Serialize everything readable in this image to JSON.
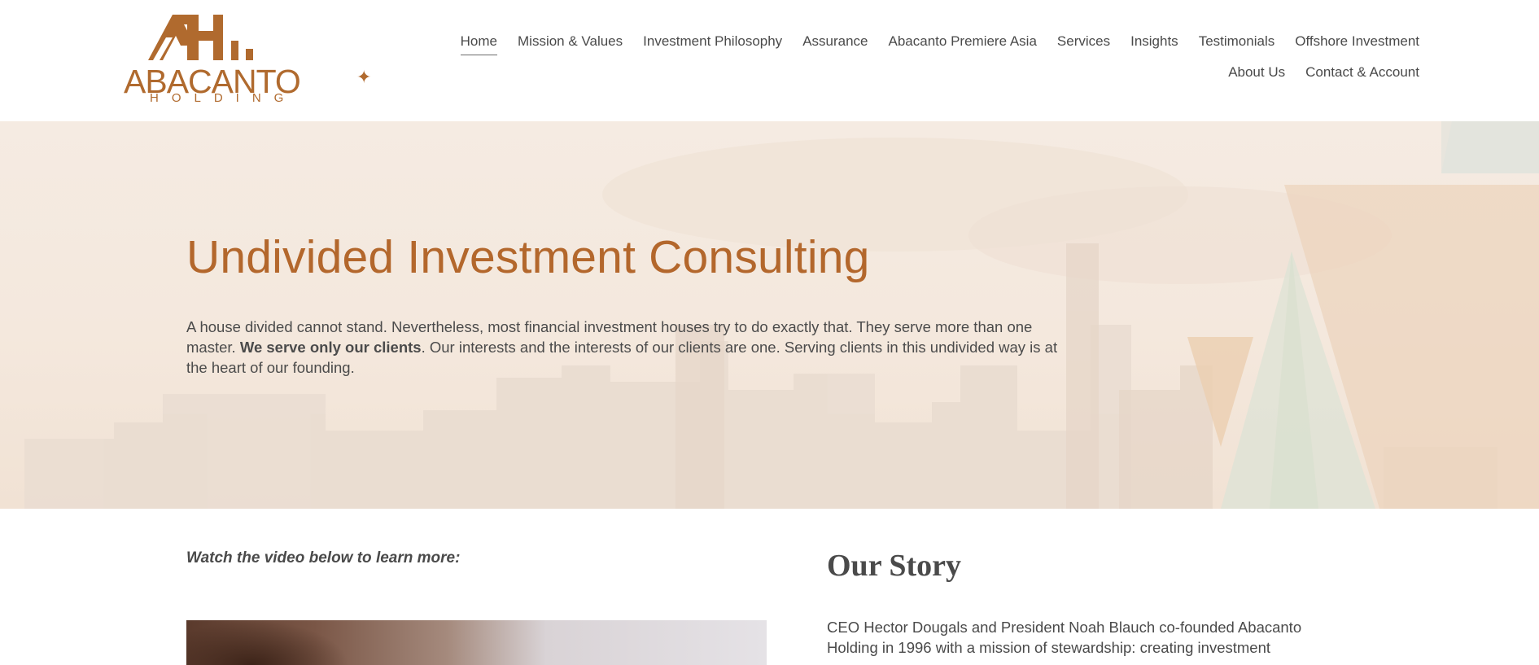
{
  "brand": {
    "name": "ABACANTO",
    "sub": "HOLDING",
    "accent": "#b3672c"
  },
  "nav": {
    "row1": [
      {
        "label": "Home",
        "active": true
      },
      {
        "label": "Mission & Values"
      },
      {
        "label": "Investment Philosophy"
      },
      {
        "label": "Assurance"
      },
      {
        "label": "Abacanto Premiere Asia"
      },
      {
        "label": "Services"
      },
      {
        "label": "Insights"
      },
      {
        "label": "Testimonials"
      },
      {
        "label": "Offshore Investment"
      }
    ],
    "row2": [
      {
        "label": "About Us"
      },
      {
        "label": "Contact & Account"
      }
    ]
  },
  "hero": {
    "title": "Undivided Investment Consulting",
    "text_before": "A house divided cannot stand. Nevertheless, most financial investment houses try to do exactly that. They serve more than one master. ",
    "text_bold": "We serve only our clients",
    "text_after": ". Our interests and the interests of our clients are one. Serving clients in this undivided way is at the heart of our founding."
  },
  "video": {
    "caption": "Watch the video below to learn more:"
  },
  "story": {
    "title": "Our Story",
    "text": "CEO Hector Dougals and President Noah Blauch co-founded Abacanto Holding in 1996 with a mission of stewardship: creating investment"
  }
}
